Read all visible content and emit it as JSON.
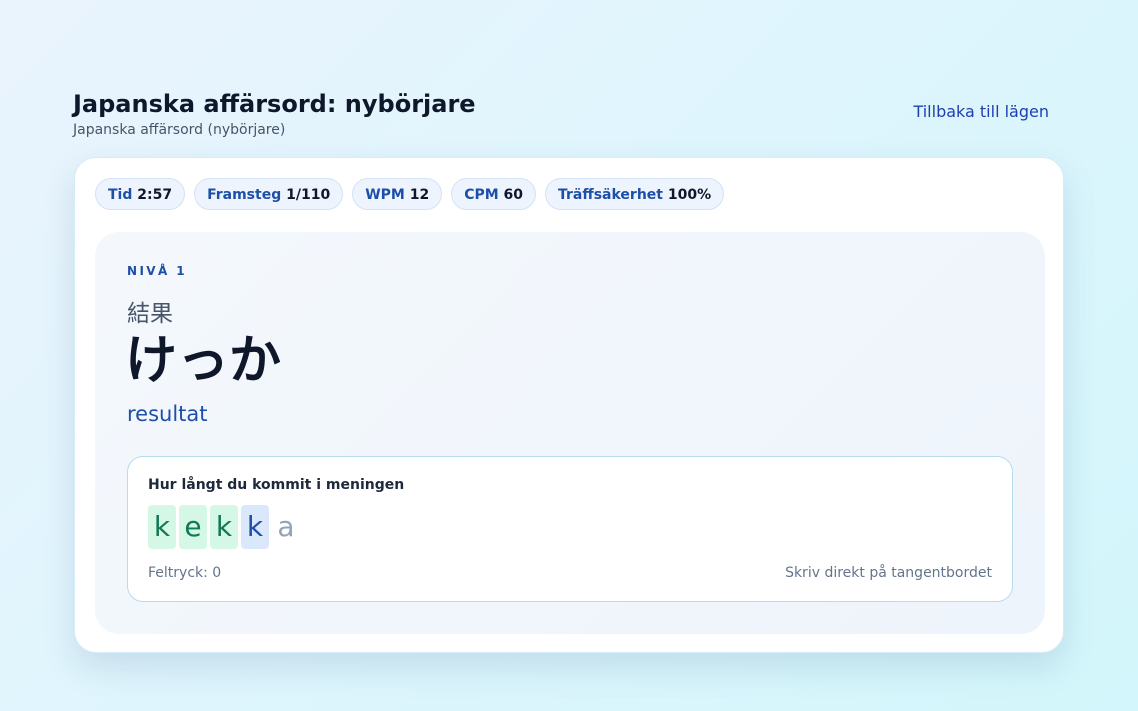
{
  "header": {
    "title": "Japanska affärsord: nybörjare",
    "subtitle": "Japanska affärsord (nybörjare)",
    "back_link": "Tillbaka till lägen"
  },
  "stats": {
    "time": {
      "label": "Tid",
      "value": "2:57"
    },
    "progress": {
      "label": "Framsteg",
      "value": "1/110"
    },
    "wpm": {
      "label": "WPM",
      "value": "12"
    },
    "cpm": {
      "label": "CPM",
      "value": "60"
    },
    "accuracy": {
      "label": "Träffsäkerhet",
      "value": "100%"
    }
  },
  "exercise": {
    "level": "NIVÅ 1",
    "kanji": "結果",
    "kana": "けっか",
    "meaning": "resultat"
  },
  "typing": {
    "label": "Hur långt du kommit i meningen",
    "chars": [
      {
        "char": "k",
        "state": "done"
      },
      {
        "char": "e",
        "state": "done"
      },
      {
        "char": "k",
        "state": "done"
      },
      {
        "char": "k",
        "state": "current"
      },
      {
        "char": "a",
        "state": "pending"
      }
    ],
    "errors": "Feltryck: 0",
    "hint": "Skriv direkt på tangentbordet"
  },
  "colors": {
    "accent": "#1e4fa8",
    "done_bg": "#d4f7e6",
    "done_fg": "#0f7a55",
    "current_bg": "#dbe8fb",
    "pending_fg": "#94a3b8"
  }
}
